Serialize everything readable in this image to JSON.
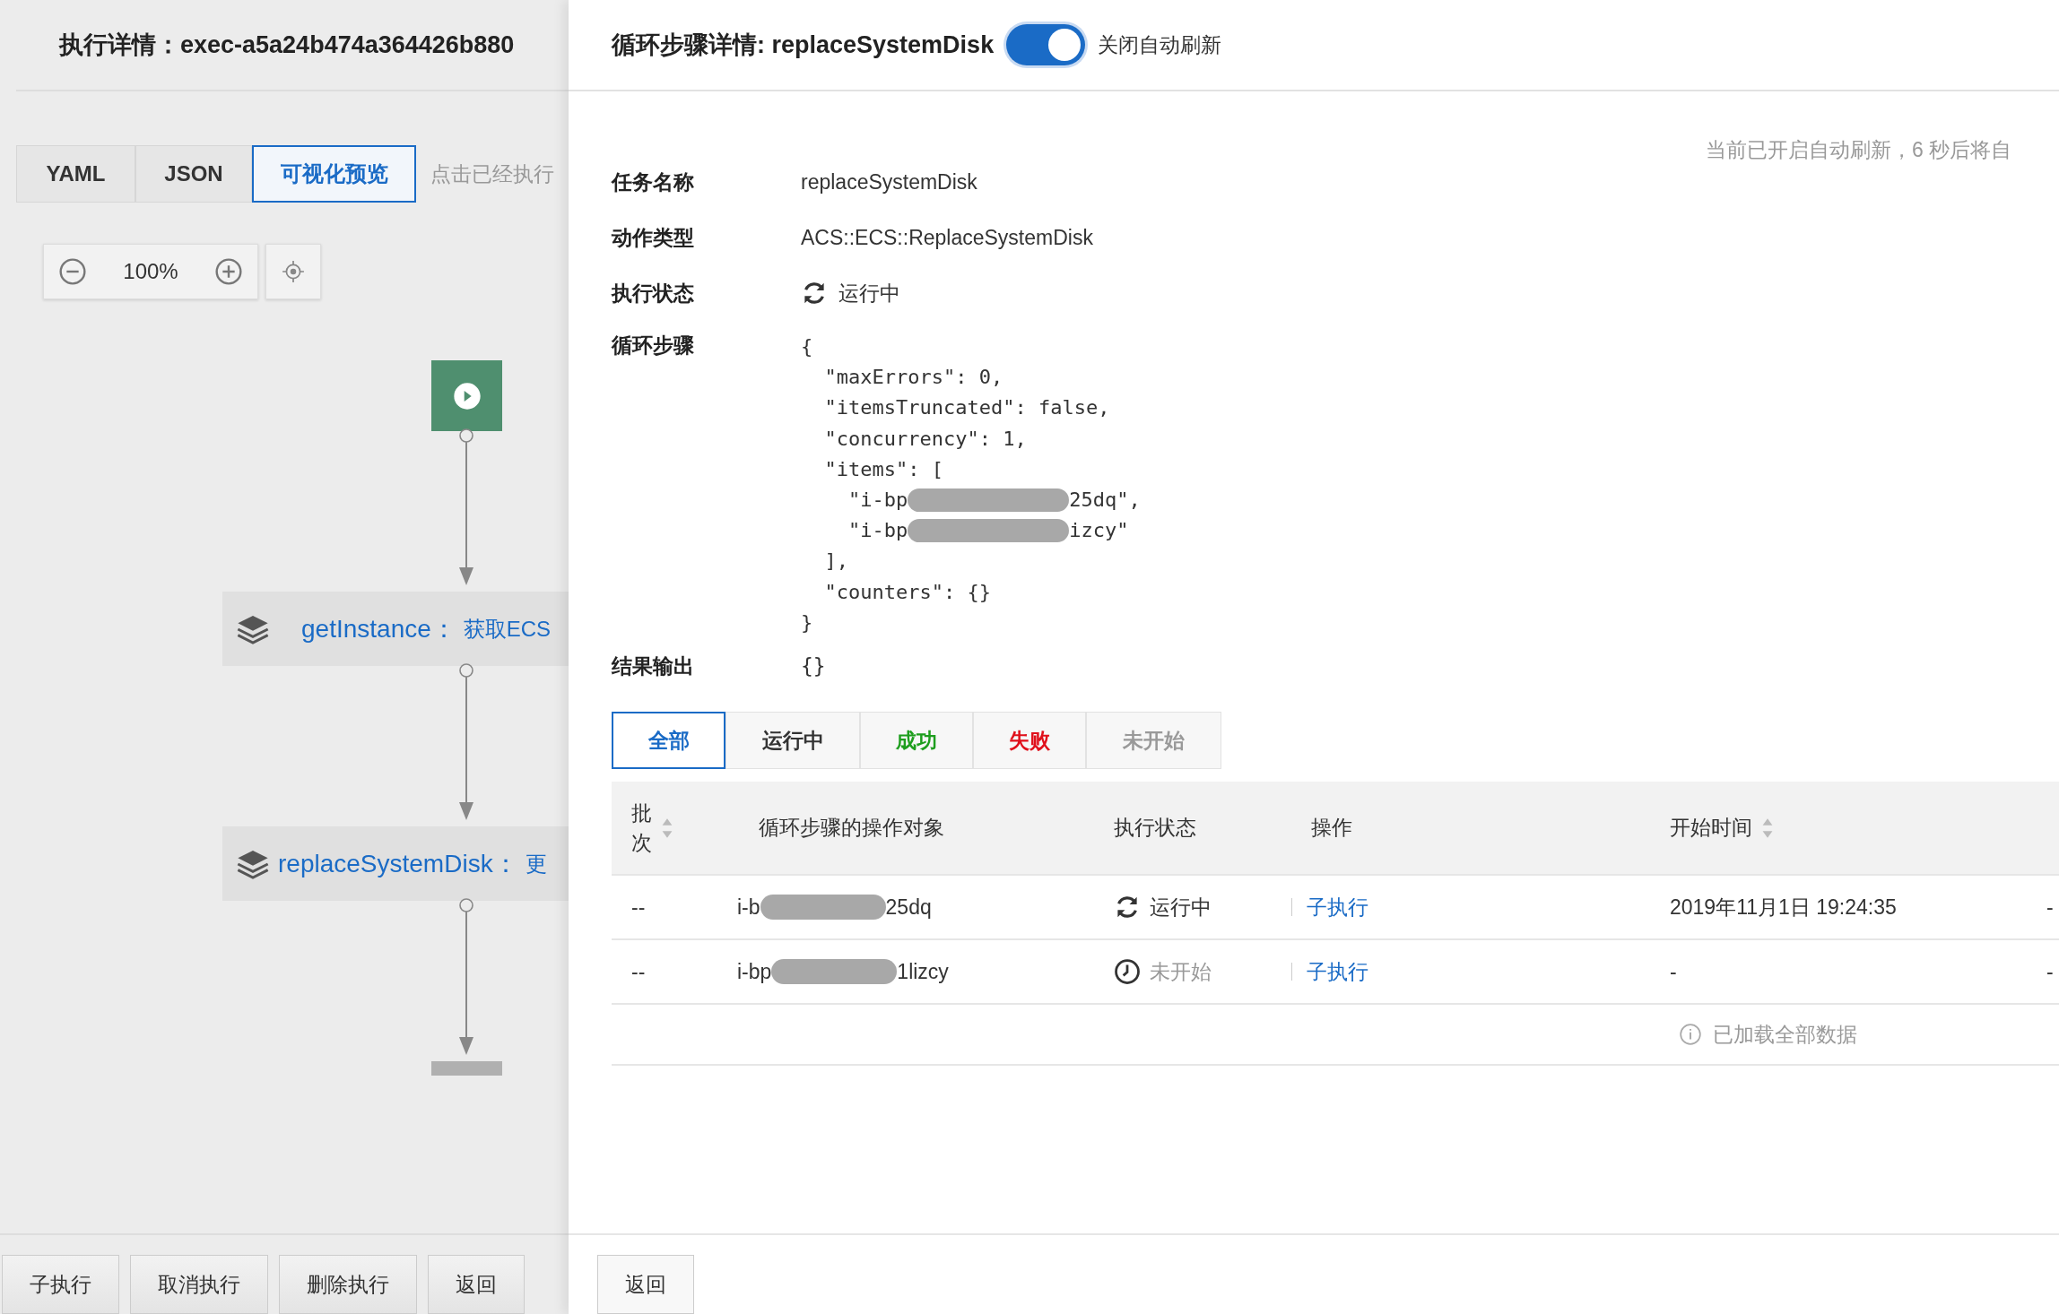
{
  "left_panel": {
    "title": "执行详情：exec-a5a24b474a364426b880",
    "view_tabs": [
      {
        "label": "YAML",
        "selected": false
      },
      {
        "label": "JSON",
        "selected": false
      },
      {
        "label": "可视化预览",
        "selected": true
      }
    ],
    "hint": "点击已经执行",
    "zoom": {
      "value": "100%"
    },
    "flow": {
      "nodes": [
        {
          "kind": "start"
        },
        {
          "kind": "task",
          "name": "getInstance：",
          "description": "获取ECS"
        },
        {
          "kind": "task",
          "name": "replaceSystemDisk：",
          "description": "更"
        },
        {
          "kind": "end"
        }
      ]
    },
    "buttons": [
      "子执行",
      "取消执行",
      "删除执行",
      "返回"
    ]
  },
  "detail_panel": {
    "title": "循环步骤详情: replaceSystemDisk",
    "auto_refresh": {
      "on": true,
      "label": "关闭自动刷新"
    },
    "refresh_notice": "当前已开启自动刷新，6 秒后将自",
    "fields": [
      {
        "kind": "text",
        "label": "任务名称",
        "value": "replaceSystemDisk"
      },
      {
        "kind": "text",
        "label": "动作类型",
        "value": "ACS::ECS::ReplaceSystemDisk"
      },
      {
        "kind": "status",
        "label": "执行状态",
        "value": "运行中"
      }
    ],
    "loop_step": {
      "label": "循环步骤",
      "lines": [
        {
          "text": "{"
        },
        {
          "text": "  \"maxErrors\": 0,"
        },
        {
          "text": "  \"itemsTruncated\": false,"
        },
        {
          "text": "  \"concurrency\": 1,"
        },
        {
          "text": "  \"items\": ["
        },
        {
          "text": "    \"i-bp",
          "redacted": true,
          "tail": "25dq\","
        },
        {
          "text": "    \"i-bp",
          "redacted": true,
          "tail": "izcy\""
        },
        {
          "text": "  ],"
        },
        {
          "text": "  \"counters\": {}"
        },
        {
          "text": "}"
        }
      ]
    },
    "output": {
      "label": "结果输出",
      "value": "{}"
    },
    "filter_tabs": [
      {
        "label": "全部",
        "selected": true,
        "color": "#1a6bc6"
      },
      {
        "label": "运行中",
        "selected": false,
        "color": "#333333"
      },
      {
        "label": "成功",
        "selected": false,
        "color": "#1e9e1e"
      },
      {
        "label": "失败",
        "selected": false,
        "color": "#e0101b"
      },
      {
        "label": "未开始",
        "selected": false,
        "color": "#999999"
      }
    ],
    "table": {
      "columns": [
        {
          "label": "批次",
          "sortable": true
        },
        {
          "label": "循环步骤的操作对象",
          "sortable": false
        },
        {
          "label": "执行状态",
          "sortable": false
        },
        {
          "label": "操作",
          "sortable": false
        },
        {
          "label": "开始时间",
          "sortable": true
        }
      ],
      "rows": [
        {
          "batch": "--",
          "target": {
            "prefix": "i-b",
            "suffix": "25dq"
          },
          "status": {
            "kind": "running",
            "text": "运行中"
          },
          "action": "子执行",
          "start_time": "2019年11月1日 19:24:35",
          "column_6": "-"
        },
        {
          "batch": "--",
          "target": {
            "prefix": "i-bp",
            "suffix": "1lizcy"
          },
          "status": {
            "kind": "pending",
            "text": "未开始"
          },
          "action": "子执行",
          "start_time": "-",
          "column_6": "-"
        }
      ],
      "footer": "已加载全部数据"
    },
    "buttons": [
      "返回"
    ]
  }
}
